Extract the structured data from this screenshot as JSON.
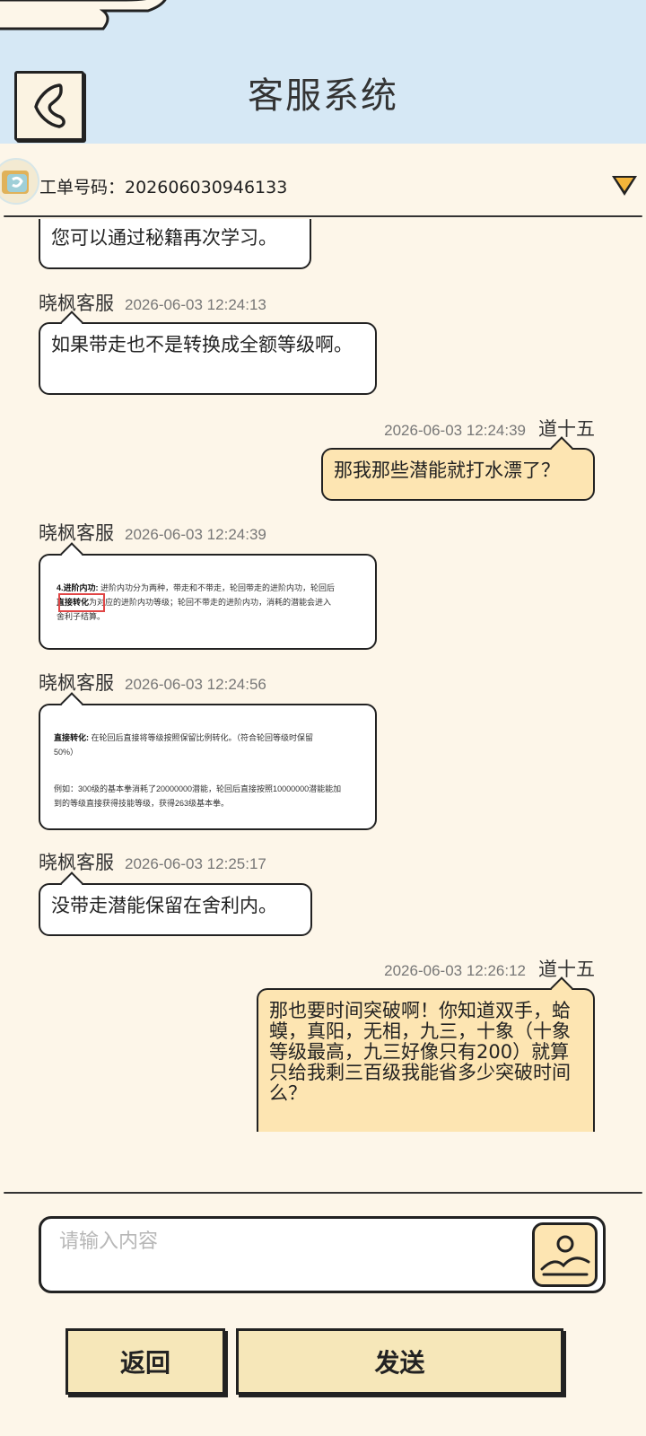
{
  "header": {
    "title": "客服系统"
  },
  "ticket": {
    "label": "工单号码：202606030946133"
  },
  "messages": [
    {
      "side": "other",
      "text": "您可以通过秘籍再次学习。"
    },
    {
      "side": "other",
      "sender": "晓枫客服",
      "time": "2026-06-03 12:24:13",
      "text": "如果带走也不是转换成全额等级啊。"
    },
    {
      "side": "mine",
      "sender": "道十五",
      "time": "2026-06-03 12:24:39",
      "text": "那我那些潜能就打水漂了？"
    },
    {
      "side": "other",
      "sender": "晓枫客服",
      "time": "2026-06-03 12:24:39",
      "type": "image",
      "image_text": {
        "bold1": "4.进阶内功:",
        "line1": "进阶内功分为两种，带走和不带走，轮回带走的进阶内功，轮回后",
        "bold2": "直接转化",
        "line2": "为对应的进阶内功等级；轮回不带走的进阶内功，消耗的潜能会进入",
        "line3": "舍利子结算。"
      }
    },
    {
      "side": "other",
      "sender": "晓枫客服",
      "time": "2026-06-03 12:24:56",
      "type": "image",
      "image_text": {
        "bold1": "直接转化:",
        "line1": "在轮回后直接将等级按照保留比例转化。（符合轮回等级时保留",
        "line2": "50%）",
        "line3": "例如：300级的基本拳消耗了20000000潜能，轮回后直接按照10000000潜能能加",
        "line4": "到的等级直接获得技能等级，获得263级基本拳。"
      }
    },
    {
      "side": "other",
      "sender": "晓枫客服",
      "time": "2026-06-03 12:25:17",
      "text": "没带走潜能保留在舍利内。"
    },
    {
      "side": "mine",
      "sender": "道十五",
      "time": "2026-06-03 12:26:12",
      "text": "那也要时间突破啊！你知道双手，蛤蟆，真阳，无相，九三，十象（十象等级最高，九三好像只有200）就算只给我剩三百级我能省多少突破时间么？"
    }
  ],
  "input": {
    "placeholder": "请输入内容",
    "value": ""
  },
  "buttons": {
    "back_label": "返回",
    "send_label": "发送"
  },
  "colors": {
    "header_bg": "#d6e8f5",
    "page_bg": "#fdf6e9",
    "my_bubble": "#fde5b2",
    "button_bg": "#f6e7b9",
    "dropdown_arrow": "#f3b43a"
  },
  "icons": {
    "back": "back-arrow-icon",
    "dropdown": "triangle-down-icon",
    "image": "image-upload-icon"
  }
}
